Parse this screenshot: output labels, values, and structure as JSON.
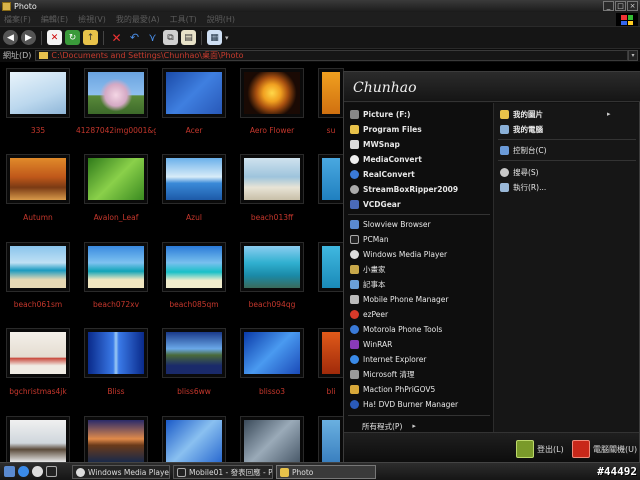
{
  "window": {
    "title": "Photo"
  },
  "menu": {
    "items": [
      "檔案(F)",
      "編輯(E)",
      "檢視(V)",
      "我的最愛(A)",
      "工具(T)",
      "說明(H)"
    ]
  },
  "address": {
    "label": "網址(D)",
    "path": "C:\\Documents and Settings\\Chunhao\\桌面\\Photo"
  },
  "files": [
    {
      "name": "335"
    },
    {
      "name": "41287042img0001&g"
    },
    {
      "name": "Acer"
    },
    {
      "name": "Aero Flower"
    },
    {
      "name": "su"
    },
    {
      "name": "Autumn"
    },
    {
      "name": "Avalon_Leaf"
    },
    {
      "name": "Azul"
    },
    {
      "name": "beach013ff"
    },
    {
      "name": ""
    },
    {
      "name": "beach061sm"
    },
    {
      "name": "beach072xv"
    },
    {
      "name": "beach085qm"
    },
    {
      "name": "beach094qg"
    },
    {
      "name": ""
    },
    {
      "name": "bgchristmas4jk"
    },
    {
      "name": "Bliss"
    },
    {
      "name": "bliss6ww"
    },
    {
      "name": "blisso3"
    },
    {
      "name": "bli"
    },
    {
      "name": ""
    },
    {
      "name": ""
    },
    {
      "name": ""
    },
    {
      "name": ""
    },
    {
      "name": ""
    }
  ],
  "start_menu": {
    "user": "Chunhao",
    "left_top": [
      {
        "label": "Picture (F:)",
        "icon": "drive-icon"
      },
      {
        "label": "Program Files",
        "icon": "folder-icon"
      },
      {
        "label": "MWSnap",
        "icon": "mwsnap-icon"
      },
      {
        "label": "MediaConvert",
        "icon": "mediaconvert-icon"
      },
      {
        "label": "RealConvert",
        "icon": "realconvert-icon"
      },
      {
        "label": "StreamBoxRipper2009",
        "icon": "streambox-icon"
      },
      {
        "label": "VCDGear",
        "icon": "vcdgear-icon"
      }
    ],
    "left_bottom": [
      {
        "label": "Slowview Browser",
        "icon": "slowview-icon"
      },
      {
        "label": "PCMan",
        "icon": "pcman-icon"
      },
      {
        "label": "Windows Media Player",
        "icon": "wmp-icon"
      },
      {
        "label": "小畫家",
        "icon": "paint-icon"
      },
      {
        "label": "記事本",
        "icon": "notepad-icon"
      },
      {
        "label": "Mobile Phone Manager",
        "icon": "phone-manager-icon"
      },
      {
        "label": "ezPeer",
        "icon": "ezpeer-icon"
      },
      {
        "label": "Motorola Phone Tools",
        "icon": "motorola-icon"
      },
      {
        "label": "WinRAR",
        "icon": "winrar-icon"
      },
      {
        "label": "Internet Explorer",
        "icon": "ie-icon"
      },
      {
        "label": "Microsoft 清理",
        "icon": "cleaner-icon"
      },
      {
        "label": "Maction PhPriGOV5",
        "icon": "maction-icon"
      },
      {
        "label": "Ha! DVD Burner Manager",
        "icon": "dvd-icon"
      }
    ],
    "all_programs": "所有程式(P)",
    "right": [
      {
        "label": "我的圖片",
        "icon": "pictures-icon",
        "arrow": "▸"
      },
      {
        "label": "我的電腦",
        "icon": "computer-icon"
      },
      {
        "label": "控制台(C)",
        "icon": "control-panel-icon"
      },
      {
        "label": "搜尋(S)",
        "icon": "search-icon"
      },
      {
        "label": "執行(R)...",
        "icon": "run-icon"
      }
    ],
    "logoff": "登出(L)",
    "shutdown": "電腦關機(U)"
  },
  "taskbar": {
    "tasks": [
      {
        "label": "Windows Media Player"
      },
      {
        "label": "Mobile01 - 發表回應 - P..."
      },
      {
        "label": "Photo"
      }
    ],
    "watermark": "#44492"
  }
}
